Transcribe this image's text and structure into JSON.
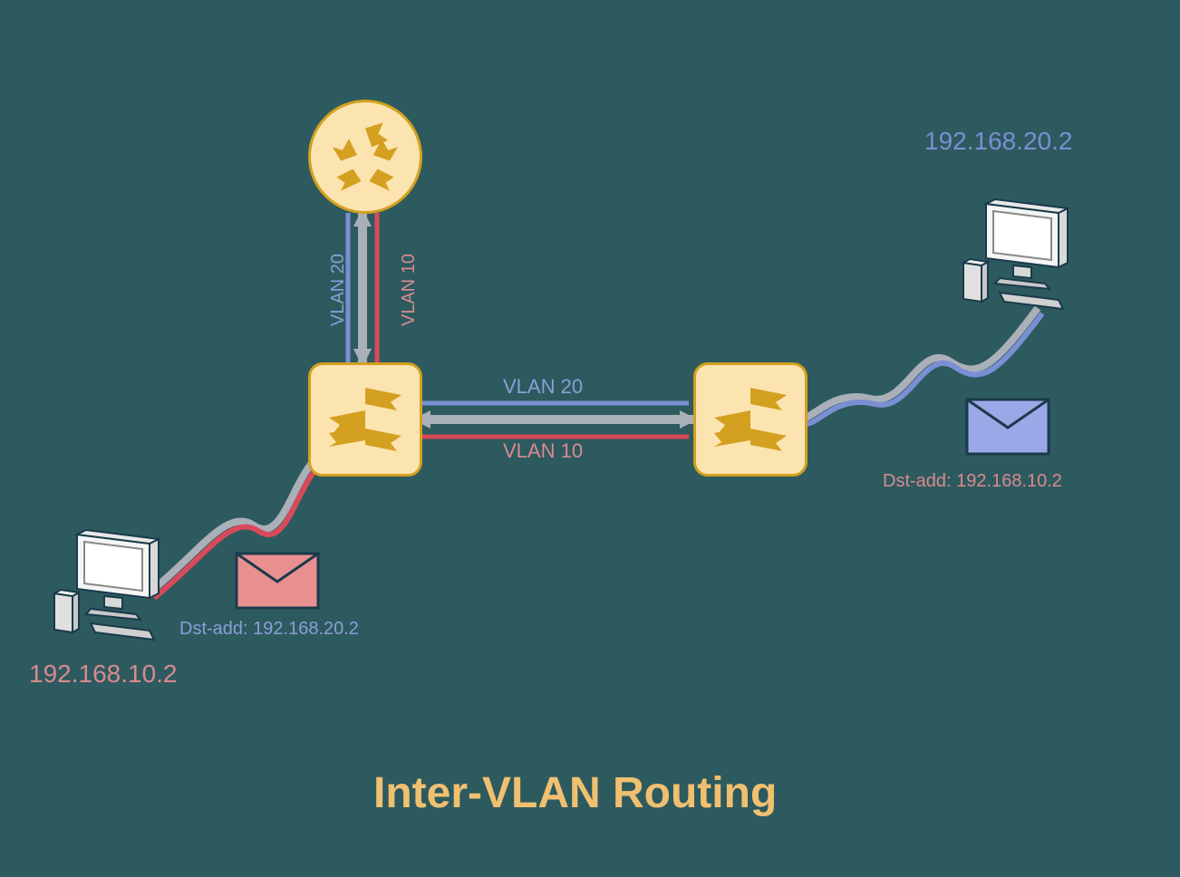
{
  "title": "Inter-VLAN Routing",
  "pc_left": {
    "ip": "192.168.10.2"
  },
  "pc_right": {
    "ip": "192.168.20.2"
  },
  "packet_left": {
    "dst": "Dst-add: 192.168.20.2"
  },
  "packet_right": {
    "dst": "Dst-add: 192.168.10.2"
  },
  "link_horizontal": {
    "vlan20": "VLAN 20",
    "vlan10": "VLAN 10"
  },
  "link_vertical": {
    "vlan20": "VLAN 20",
    "vlan10": "VLAN 10"
  },
  "colors": {
    "vlan10": "#d84a5a",
    "vlan20": "#7a8fd4",
    "link_gray": "#aab0b8",
    "device_fill": "#fce4b0",
    "device_stroke": "#d4a020",
    "arrow": "#d4a020"
  }
}
